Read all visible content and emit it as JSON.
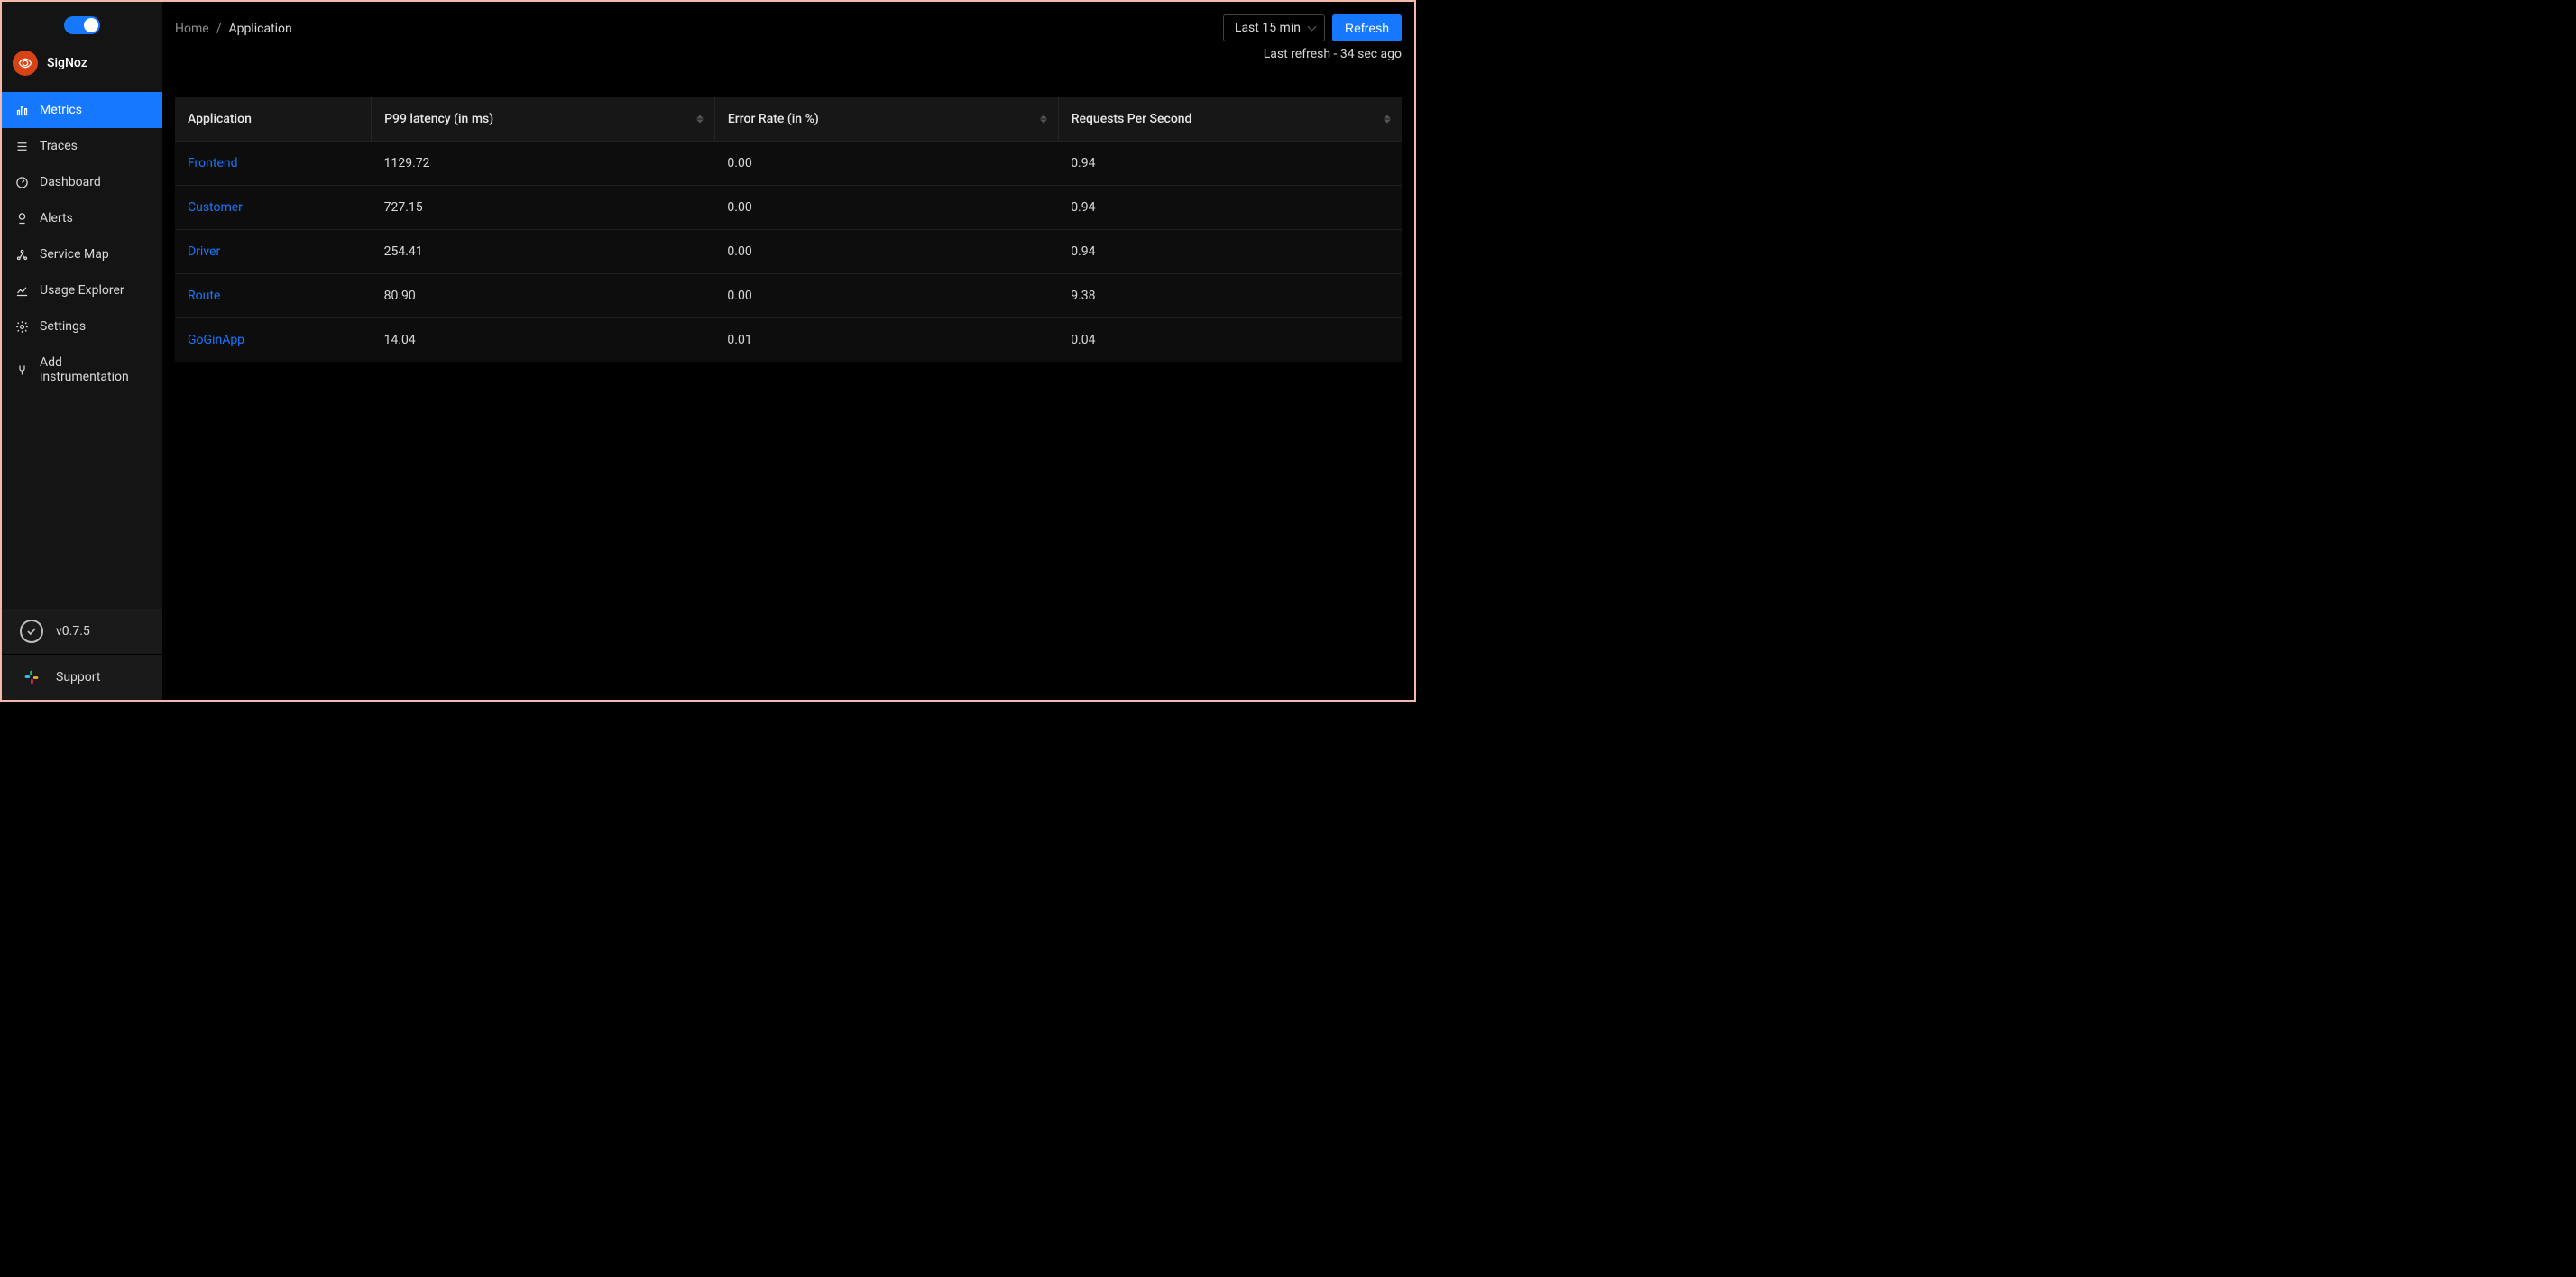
{
  "brand": {
    "name": "SigNoz"
  },
  "sidebar": {
    "items": [
      {
        "label": "Metrics"
      },
      {
        "label": "Traces"
      },
      {
        "label": "Dashboard"
      },
      {
        "label": "Alerts"
      },
      {
        "label": "Service Map"
      },
      {
        "label": "Usage Explorer"
      },
      {
        "label": "Settings"
      },
      {
        "label": "Add instrumentation"
      }
    ],
    "footer": {
      "version": "v0.7.5",
      "support": "Support"
    }
  },
  "breadcrumb": {
    "home": "Home",
    "current": "Application"
  },
  "topbar": {
    "time_range": "Last 15 min",
    "refresh_label": "Refresh",
    "last_refresh": "Last refresh - 34 sec ago"
  },
  "table": {
    "columns": {
      "application": "Application",
      "p99": "P99 latency (in ms)",
      "error_rate": "Error Rate (in %)",
      "rps": "Requests Per Second"
    },
    "rows": [
      {
        "name": "Frontend",
        "p99": "1129.72",
        "err": "0.00",
        "rps": "0.94"
      },
      {
        "name": "Customer",
        "p99": "727.15",
        "err": "0.00",
        "rps": "0.94"
      },
      {
        "name": "Driver",
        "p99": "254.41",
        "err": "0.00",
        "rps": "0.94"
      },
      {
        "name": "Route",
        "p99": "80.90",
        "err": "0.00",
        "rps": "9.38"
      },
      {
        "name": "GoGinApp",
        "p99": "14.04",
        "err": "0.01",
        "rps": "0.04"
      }
    ]
  }
}
